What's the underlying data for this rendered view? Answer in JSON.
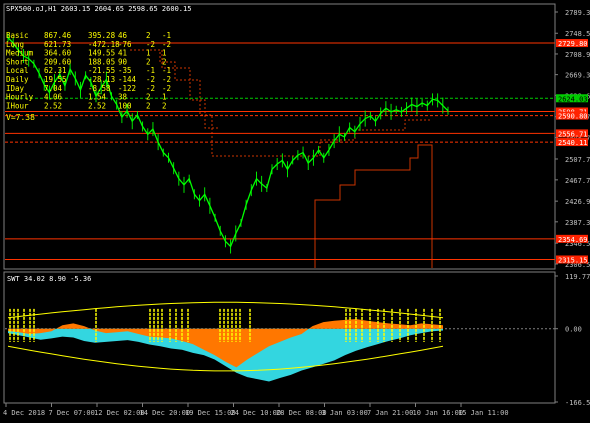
{
  "window": {
    "symbol_line": "SPX500.oJ,H1  2603.15 2604.65 2598.65 2600.15"
  },
  "indicator_table": [
    {
      "name": "Basic",
      "c1": "867.46",
      "c2": "395.28",
      "c3": "46",
      "c4": "2",
      "c5": "-1"
    },
    {
      "name": "Long",
      "c1": "621.73",
      "c2": "-472.18",
      "c3": "-76",
      "c4": "-2",
      "c5": "-2"
    },
    {
      "name": "Medium",
      "c1": "364.60",
      "c2": "149.55",
      "c3": "41",
      "c4": "1",
      "c5": "1"
    },
    {
      "name": "Short",
      "c1": "209.60",
      "c2": "188.05",
      "c3": "90",
      "c4": "2",
      "c5": "2"
    },
    {
      "name": "Local",
      "c1": "62.31",
      "c2": "-21.55",
      "c3": "-35",
      "c4": "-1",
      "c5": "-1"
    },
    {
      "name": "Daily",
      "c1": "19.55",
      "c2": "-28.13",
      "c3": "-144",
      "c4": "-2",
      "c5": "-2"
    },
    {
      "name": "IDay",
      "c1": "7.04",
      "c2": "-8.58",
      "c3": "-122",
      "c4": "-2",
      "c5": "-2"
    },
    {
      "name": "Hourly",
      "c1": "4.06",
      "c2": "1.54",
      "c3": "38",
      "c4": "2",
      "c5": "1"
    },
    {
      "name": "IHour",
      "c1": "2.52",
      "c2": "2.52",
      "c3": "100",
      "c4": "2",
      "c5": "2"
    }
  ],
  "vol_text": "V=7.38",
  "oscillator": {
    "label": "SWT 34.02 8.90 -5.36",
    "ticks": [
      "119.77",
      "0.00",
      "-166.59"
    ]
  },
  "colors": {
    "price": "#00ff00",
    "level": "#ff3300",
    "stair": "#cc3300",
    "tag_bg": "#ff2200",
    "tag_green": "#00cc00",
    "table_text": "#ffff00",
    "osc_cyan": "#33d6e0",
    "osc_orange": "#ff7700",
    "osc_yellow": "#ffff00",
    "grid": "#808080"
  },
  "chart_data": [
    {
      "type": "line",
      "title": "SPX500.oJ,H1",
      "xlabel": "",
      "ylabel": "",
      "ylim": [
        2306.5,
        2789.3
      ],
      "y_ticks": [
        2789.3,
        2748.59,
        2708.9,
        2669.3,
        2629.65,
        2588.7,
        2548.7,
        2507.7,
        2467.7,
        2426.9,
        2387.3,
        2346.5,
        2306.5
      ],
      "x_ticks": [
        "4 Dec 2018",
        "7 Dec 07:00",
        "12 Dec 02:00",
        "14 Dec 20:00",
        "19 Dec 15:00",
        "24 Dec 10:00",
        "28 Dec 08:00",
        "3 Jan 03:00",
        "7 Jan 21:00",
        "10 Jan 16:00",
        "15 Jan 11:00"
      ],
      "series": [
        {
          "x": [
            0,
            3,
            6,
            9,
            12,
            15,
            18,
            21,
            24,
            27,
            30,
            33,
            36,
            39,
            42,
            45,
            48,
            51,
            54,
            57,
            60,
            63,
            66,
            69,
            72,
            75,
            78,
            81,
            84,
            87,
            90,
            93,
            96,
            99,
            102,
            105,
            108,
            111,
            114,
            117,
            120,
            123,
            126,
            129,
            132,
            135,
            138,
            141,
            144,
            147,
            150,
            153,
            156,
            159,
            162,
            165,
            168,
            171,
            174,
            177,
            180,
            183,
            186,
            189,
            192,
            195,
            198,
            201,
            204,
            207,
            210,
            213,
            216,
            219,
            222,
            225,
            228,
            231,
            234,
            237,
            240,
            243,
            246,
            249,
            252,
            255
          ],
          "values": [
            2740,
            2730,
            2716,
            2705,
            2700,
            2690,
            2672,
            2650,
            2635,
            2655,
            2670,
            2648,
            2680,
            2662,
            2640,
            2668,
            2655,
            2628,
            2645,
            2660,
            2628,
            2612,
            2588,
            2600,
            2580,
            2592,
            2570,
            2555,
            2565,
            2540,
            2520,
            2510,
            2490,
            2470,
            2458,
            2470,
            2440,
            2428,
            2440,
            2418,
            2395,
            2370,
            2350,
            2340,
            2365,
            2385,
            2420,
            2448,
            2470,
            2460,
            2452,
            2488,
            2498,
            2505,
            2488,
            2505,
            2515,
            2520,
            2500,
            2510,
            2525,
            2510,
            2525,
            2542,
            2555,
            2550,
            2568,
            2560,
            2575,
            2585,
            2590,
            2580,
            2595,
            2605,
            2598,
            2602,
            2598,
            2605,
            2612,
            2608,
            2615,
            2610,
            2622,
            2620,
            2610,
            2600
          ]
        }
      ],
      "levels": [
        {
          "value": "2729.80",
          "style": "solid"
        },
        {
          "value": "2624.03",
          "style": "dashed",
          "tag_color": "green"
        },
        {
          "value": "2598.71",
          "style": "solid"
        },
        {
          "value": "2590.80",
          "style": "dashed"
        },
        {
          "value": "2556.71",
          "style": "solid"
        },
        {
          "value": "2540.11",
          "style": "dashed"
        },
        {
          "value": "2354.69",
          "style": "solid"
        },
        {
          "value": "2315.15",
          "style": "solid"
        }
      ]
    },
    {
      "type": "area",
      "title": "SWT 34.02 8.90 -5.36",
      "ylim": [
        -166.59,
        119.77
      ],
      "series": [
        {
          "name": "",
          "color": "cyan",
          "values": [
            -10,
            -15,
            -20,
            -25,
            -22,
            -18,
            -20,
            -28,
            -32,
            -30,
            -28,
            -26,
            -30,
            -36,
            -40,
            -45,
            -48,
            -55,
            -60,
            -70,
            -85,
            -100,
            -110,
            -115,
            -120,
            -112,
            -105,
            -95,
            -88,
            -80,
            -72,
            -60,
            -50,
            -42,
            -35,
            -28,
            -22,
            -15,
            -10,
            -6,
            -4
          ]
        },
        {
          "name": "",
          "color": "orange",
          "values": [
            -5,
            -8,
            -12,
            -10,
            -6,
            8,
            12,
            6,
            -4,
            -10,
            -8,
            -6,
            -12,
            -18,
            -20,
            -22,
            -28,
            -35,
            -48,
            -60,
            -75,
            -88,
            -70,
            -55,
            -40,
            -30,
            -20,
            -12,
            6,
            15,
            18,
            20,
            22,
            18,
            15,
            12,
            10,
            8,
            12,
            10,
            8
          ]
        }
      ]
    }
  ]
}
